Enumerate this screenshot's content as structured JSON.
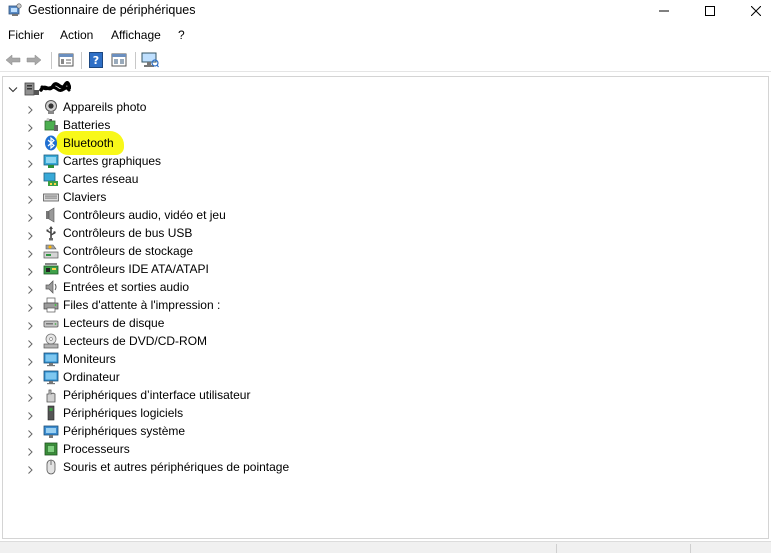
{
  "window": {
    "title": "Gestionnaire de périphériques",
    "icons": {
      "app": "device-manager-icon"
    }
  },
  "menu": [
    {
      "label": "Fichier"
    },
    {
      "label": "Action"
    },
    {
      "label": "Affichage"
    },
    {
      "label": "?"
    }
  ],
  "toolbar": {
    "buttons": [
      "back-icon",
      "forward-icon",
      "properties-icon",
      "help-icon",
      "show-hidden-icon",
      "scan-hardware-icon"
    ]
  },
  "tree": {
    "root_expanded": true,
    "items": [
      {
        "label": "Appareils photo",
        "icon": "camera-icon"
      },
      {
        "label": "Batteries",
        "icon": "battery-icon"
      },
      {
        "label": "Bluetooth",
        "icon": "bluetooth-icon",
        "highlighted": true
      },
      {
        "label": "Cartes graphiques",
        "icon": "display-adapter-icon"
      },
      {
        "label": "Cartes réseau",
        "icon": "network-adapter-icon"
      },
      {
        "label": "Claviers",
        "icon": "keyboard-icon"
      },
      {
        "label": "Contrôleurs audio, vidéo et jeu",
        "icon": "speaker-icon"
      },
      {
        "label": "Contrôleurs de bus USB",
        "icon": "usb-icon"
      },
      {
        "label": "Contrôleurs de stockage",
        "icon": "storage-controller-icon"
      },
      {
        "label": "Contrôleurs IDE ATA/ATAPI",
        "icon": "ide-controller-icon"
      },
      {
        "label": "Entrées et sorties audio",
        "icon": "audio-io-icon"
      },
      {
        "label": "Files d'attente à l'impression :",
        "icon": "printer-queue-icon"
      },
      {
        "label": "Lecteurs de disque",
        "icon": "disk-drive-icon"
      },
      {
        "label": "Lecteurs de DVD/CD-ROM",
        "icon": "dvd-drive-icon"
      },
      {
        "label": "Moniteurs",
        "icon": "monitor-icon"
      },
      {
        "label": "Ordinateur",
        "icon": "computer-icon"
      },
      {
        "label": "Périphériques d’interface utilisateur",
        "icon": "hid-icon"
      },
      {
        "label": "Périphériques logiciels",
        "icon": "software-device-icon"
      },
      {
        "label": "Périphériques système",
        "icon": "system-device-icon"
      },
      {
        "label": "Processeurs",
        "icon": "processor-icon"
      },
      {
        "label": "Souris et autres périphériques de pointage",
        "icon": "mouse-icon"
      }
    ]
  },
  "colors": {
    "highlight": "#f7f700",
    "bluetooth": "#1f6fd1"
  }
}
